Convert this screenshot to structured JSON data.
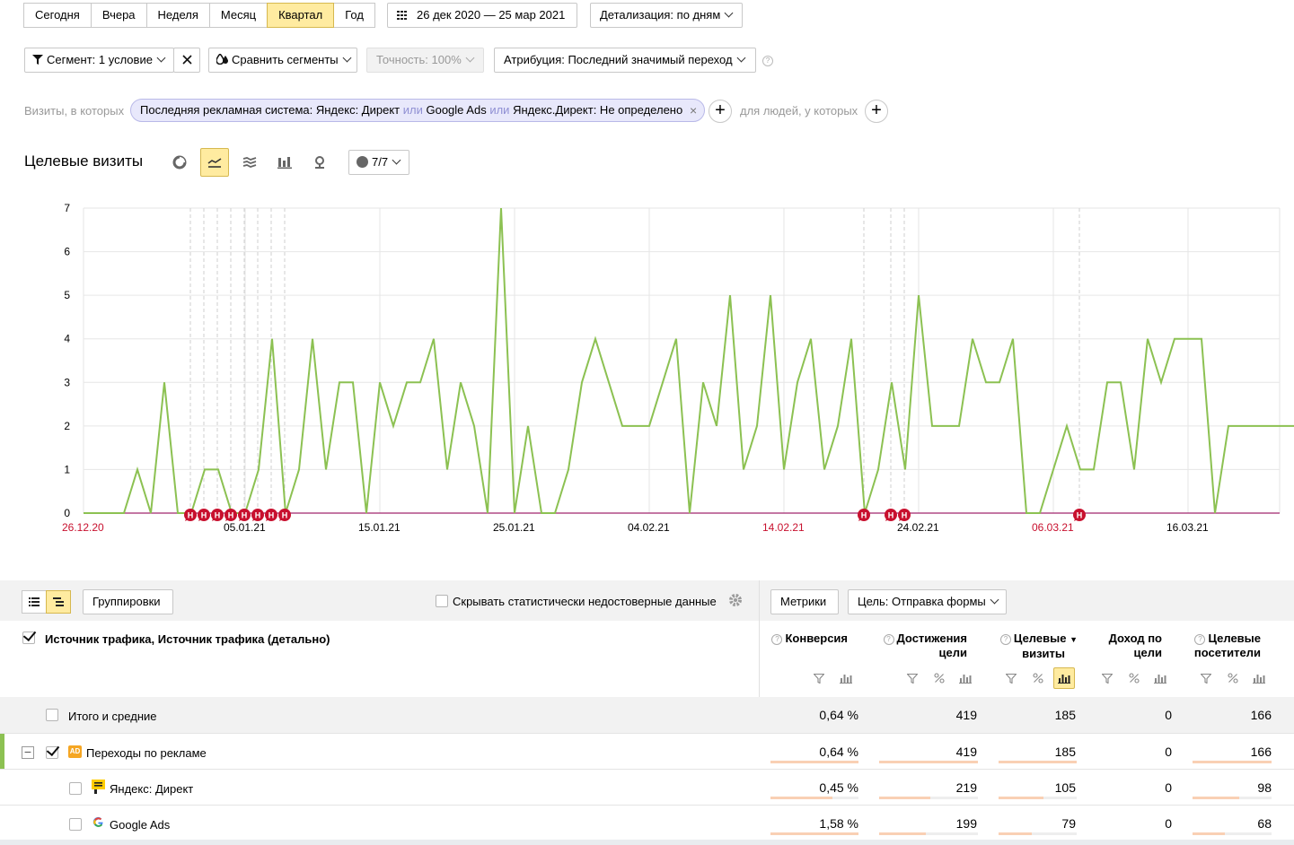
{
  "periods": [
    "Сегодня",
    "Вчера",
    "Неделя",
    "Месяц",
    "Квартал",
    "Год"
  ],
  "active_period": "Квартал",
  "date_range": "26 дек 2020 — 25 мар 2021",
  "detail": "Детализация: по дням",
  "segment": "Сегмент: 1 условие",
  "compare": "Сравнить сегменты",
  "accuracy": "Точность: 100%",
  "attribution": "Атрибуция: Последний значимый переход",
  "segment_row": {
    "prefix": "Визиты, в которых",
    "cond_main": "Последняя рекламная система: Яндекс: Директ",
    "or1": "или",
    "cond2": "Google Ads",
    "or2": "или",
    "cond3": "Яндекс.Директ: Не определено",
    "people": "для людей, у которых"
  },
  "chart_section": {
    "title": "Целевые визиты",
    "series_count": "7/7"
  },
  "chart_data": {
    "type": "line",
    "ylim": [
      0,
      7
    ],
    "yticks": [
      0,
      1,
      2,
      3,
      4,
      5,
      6,
      7
    ],
    "x_tick_labels": [
      {
        "label": "26.12.20",
        "day": 0,
        "holiday": true
      },
      {
        "label": "05.01.21",
        "day": 10,
        "holiday": false
      },
      {
        "label": "15.01.21",
        "day": 20,
        "holiday": false
      },
      {
        "label": "25.01.21",
        "day": 30,
        "holiday": false
      },
      {
        "label": "04.02.21",
        "day": 40,
        "holiday": false
      },
      {
        "label": "14.02.21",
        "day": 50,
        "holiday": true
      },
      {
        "label": "24.02.21",
        "day": 60,
        "holiday": false
      },
      {
        "label": "06.03.21",
        "day": 70,
        "holiday": true
      },
      {
        "label": "16.03.21",
        "day": 80,
        "holiday": false
      }
    ],
    "series": [
      {
        "values": [
          0,
          0,
          1,
          0,
          3,
          0,
          0,
          1,
          1,
          0,
          0,
          1,
          4,
          0,
          1,
          4,
          1,
          3,
          3,
          0,
          3,
          2,
          3,
          3,
          4,
          1,
          3,
          2,
          0,
          7,
          0,
          2,
          0,
          0,
          1,
          3,
          4,
          3,
          2,
          2,
          2,
          3,
          4,
          0,
          3,
          2,
          5,
          1,
          2,
          5,
          1,
          3,
          4,
          1,
          2,
          4,
          0,
          1,
          3,
          1,
          5,
          2,
          2,
          2,
          4,
          3,
          3,
          4,
          0,
          0,
          1,
          2,
          1,
          1,
          3,
          3,
          1,
          4,
          3,
          4,
          4,
          4,
          0,
          2,
          2,
          2,
          2,
          2,
          2,
          2
        ]
      }
    ],
    "annotations": [
      {
        "day": 6,
        "label": "Н"
      },
      {
        "day": 7,
        "label": "Н"
      },
      {
        "day": 8,
        "label": "Н"
      },
      {
        "day": 9,
        "label": "Н"
      },
      {
        "day": 10,
        "label": "Н"
      },
      {
        "day": 11,
        "label": "Н"
      },
      {
        "day": 12,
        "label": "Н"
      },
      {
        "day": 13,
        "label": "Н"
      },
      {
        "day": 56,
        "label": "Н"
      },
      {
        "day": 58,
        "label": "Н"
      },
      {
        "day": 59,
        "label": "Н"
      },
      {
        "day": 72,
        "label": "Н"
      }
    ]
  },
  "table_toolbar": {
    "groupings": "Группировки",
    "hide_label": "Скрывать статистически недостоверные данные",
    "metrics": "Метрики",
    "goal": "Цель: Отправка формы"
  },
  "columns": {
    "dimension": "Источник трафика, Источник трафика (детально)",
    "conversion": "Конверсия",
    "achievements_1": "Достижения",
    "achievements_2": "цели",
    "target_visits_1": "Целевые",
    "target_visits_2": "визиты",
    "income_1": "Доход по",
    "income_2": "цели",
    "target_visitors_1": "Целевые",
    "target_visitors_2": "посетители"
  },
  "rows": [
    {
      "name": "Итого и средние",
      "conversion": "0,64 %",
      "achievements": "419",
      "visits": "185",
      "income": "0",
      "visitors": "166"
    },
    {
      "name": "Переходы по рекламе",
      "conversion": "0,64 %",
      "achievements": "419",
      "visits": "185",
      "income": "0",
      "visitors": "166"
    },
    {
      "name": "Яндекс: Директ",
      "conversion": "0,45 %",
      "achievements": "219",
      "visits": "105",
      "income": "0",
      "visitors": "98"
    },
    {
      "name": "Google Ads",
      "conversion": "1,58 %",
      "achievements": "199",
      "visits": "79",
      "income": "0",
      "visitors": "68"
    }
  ],
  "row_bar_fractions": [
    null,
    {
      "conversion": 1.0,
      "achievements": 1.0,
      "visits": 1.0,
      "visitors": 1.0
    },
    {
      "conversion": 0.7,
      "achievements": 0.52,
      "visits": 0.57,
      "visitors": 0.59
    },
    {
      "conversion": 1.0,
      "achievements": 0.47,
      "visits": 0.43,
      "visitors": 0.41
    }
  ],
  "badges": {
    "ad": "AD"
  },
  "colors": {
    "accent": "#ffeba0",
    "line": "#8cc152",
    "holiday": "#c8102e",
    "bar": "#f9d0b4"
  }
}
